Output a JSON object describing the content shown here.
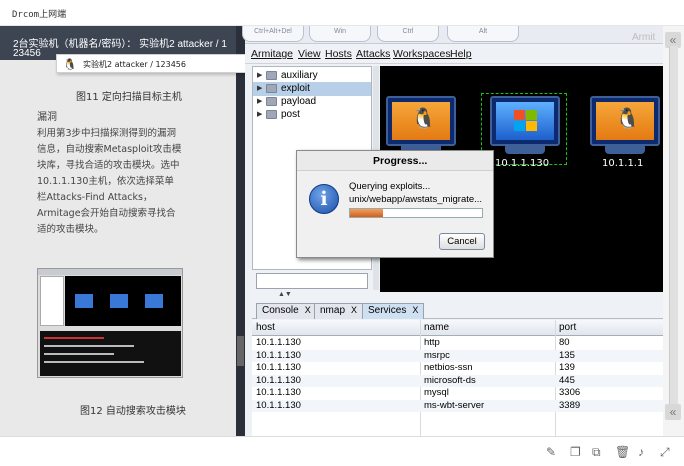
{
  "window": {
    "title": "Drcom上网端"
  },
  "doc": {
    "header_line1": "2台实验机（机器名/密码）： 实验机2 attacker / 1",
    "header_line2": "23456",
    "tooltip": "实验机2  attacker / 123456",
    "caption_top": "图11 定向扫描目标主机",
    "heading": "漏洞",
    "paragraph": "利用第3步中扫描探测得到的漏洞信息，自动搜索Metasploit攻击模块库，寻找合适的攻击模块。选中10.1.1.130主机，依次选择菜单栏Attacks-Find Attacks，Armitage会开始自动搜索寻找合适的攻击模块。",
    "caption_bottom": "图12 自动搜索攻击模块"
  },
  "armitage": {
    "keys": [
      "Ctrl+Alt+Del",
      "Win",
      "Ctrl",
      "Alt"
    ],
    "brand": "Armit",
    "menu": [
      "Armitage",
      "View",
      "Hosts",
      "Attacks",
      "Workspaces",
      "Help"
    ],
    "tree": [
      {
        "label": "auxiliary",
        "selected": false
      },
      {
        "label": "exploit",
        "selected": true
      },
      {
        "label": "payload",
        "selected": false
      },
      {
        "label": "post",
        "selected": false
      }
    ],
    "hosts": [
      {
        "label": "",
        "os": "linux"
      },
      {
        "label": "10.1.1.130",
        "os": "windows"
      },
      {
        "label": "10.1.1.1",
        "os": "linux"
      }
    ],
    "tabs": [
      {
        "label": "Console",
        "active": false
      },
      {
        "label": "nmap",
        "active": false
      },
      {
        "label": "Services",
        "active": true
      }
    ],
    "table": {
      "columns": [
        "host",
        "name",
        "port"
      ],
      "rows": [
        [
          "10.1.1.130",
          "http",
          "80"
        ],
        [
          "10.1.1.130",
          "msrpc",
          "135"
        ],
        [
          "10.1.1.130",
          "netbios-ssn",
          "139"
        ],
        [
          "10.1.1.130",
          "microsoft-ds",
          "445"
        ],
        [
          "10.1.1.130",
          "mysql",
          "3306"
        ],
        [
          "10.1.1.130",
          "ms-wbt-server",
          "3389"
        ]
      ]
    }
  },
  "dialog": {
    "title": "Progress...",
    "line1": "Querying exploits...",
    "line2": "unix/webapp/awstats_migrate...",
    "progress": 0.25,
    "cancel_label": "Cancel"
  },
  "colors": {
    "doc_header": "#3d4553",
    "selection": "#b8cfe8",
    "canvas": "#000000",
    "progress_fill": "#d06020"
  }
}
